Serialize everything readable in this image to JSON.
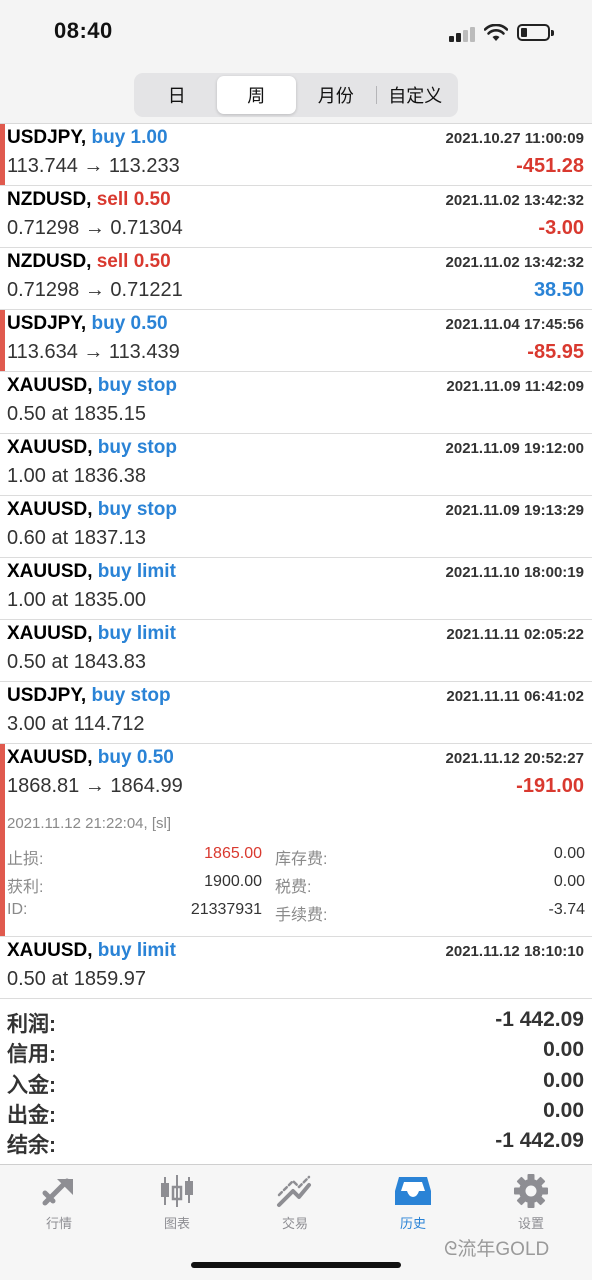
{
  "status": {
    "time": "08:40"
  },
  "segments": [
    {
      "label": "日"
    },
    {
      "label": "周",
      "active": true
    },
    {
      "label": "月份"
    },
    {
      "label": "自定义"
    }
  ],
  "rows": [
    {
      "symbol": "USDJPY,",
      "dir": "buy 1.00",
      "dir_type": "buy",
      "time": "2021.10.27 11:00:09",
      "price": "113.744 → 113.233",
      "profit": "-451.28",
      "profit_type": "neg",
      "accent": true
    },
    {
      "symbol": "NZDUSD,",
      "dir": "sell 0.50",
      "dir_type": "sell",
      "time": "2021.11.02 13:42:32",
      "price": "0.71298 → 0.71304",
      "profit": "-3.00",
      "profit_type": "neg",
      "accent": false
    },
    {
      "symbol": "NZDUSD,",
      "dir": "sell 0.50",
      "dir_type": "sell",
      "time": "2021.11.02 13:42:32",
      "price": "0.71298 → 0.71221",
      "profit": "38.50",
      "profit_type": "pos",
      "accent": false
    },
    {
      "symbol": "USDJPY,",
      "dir": "buy 0.50",
      "dir_type": "buy",
      "time": "2021.11.04 17:45:56",
      "price": "113.634 → 113.439",
      "profit": "-85.95",
      "profit_type": "neg",
      "accent": true
    },
    {
      "symbol": "XAUUSD,",
      "dir": "buy stop",
      "dir_type": "buy",
      "time": "2021.11.09 11:42:09",
      "price": "0.50 at 1835.15",
      "profit": "",
      "profit_type": "",
      "accent": false
    },
    {
      "symbol": "XAUUSD,",
      "dir": "buy stop",
      "dir_type": "buy",
      "time": "2021.11.09 19:12:00",
      "price": "1.00 at 1836.38",
      "profit": "",
      "profit_type": "",
      "accent": false
    },
    {
      "symbol": "XAUUSD,",
      "dir": "buy stop",
      "dir_type": "buy",
      "time": "2021.11.09 19:13:29",
      "price": "0.60 at 1837.13",
      "profit": "",
      "profit_type": "",
      "accent": false
    },
    {
      "symbol": "XAUUSD,",
      "dir": "buy limit",
      "dir_type": "buy",
      "time": "2021.11.10 18:00:19",
      "price": "1.00 at 1835.00",
      "profit": "",
      "profit_type": "",
      "accent": false
    },
    {
      "symbol": "XAUUSD,",
      "dir": "buy limit",
      "dir_type": "buy",
      "time": "2021.11.11 02:05:22",
      "price": "0.50 at 1843.83",
      "profit": "",
      "profit_type": "",
      "accent": false
    },
    {
      "symbol": "USDJPY,",
      "dir": "buy stop",
      "dir_type": "buy",
      "time": "2021.11.11 06:41:02",
      "price": "3.00 at 114.712",
      "profit": "",
      "profit_type": "",
      "accent": false
    },
    {
      "symbol": "XAUUSD,",
      "dir": "buy 0.50",
      "dir_type": "buy",
      "time": "2021.11.12 20:52:27",
      "price": "1868.81 → 1864.99",
      "profit": "-191.00",
      "profit_type": "neg",
      "accent": true,
      "expanded": true,
      "detail": {
        "close_info": "2021.11.12 21:22:04, [sl]",
        "sl_label": "止损:",
        "sl_value": "1865.00",
        "swap_label": "库存费:",
        "swap_value": "0.00",
        "tp_label": "获利:",
        "tp_value": "1900.00",
        "tax_label": "税费:",
        "tax_value": "0.00",
        "id_label": "ID:",
        "id_value": "21337931",
        "commission_label": "手续费:",
        "commission_value": "-3.74"
      }
    },
    {
      "symbol": "XAUUSD,",
      "dir": "buy limit",
      "dir_type": "buy",
      "time": "2021.11.12 18:10:10",
      "price": "0.50 at 1859.97",
      "profit": "",
      "profit_type": "",
      "accent": false
    }
  ],
  "summary": [
    {
      "label": "利润:",
      "value": "-1 442.09"
    },
    {
      "label": "信用:",
      "value": "0.00"
    },
    {
      "label": "入金:",
      "value": "0.00"
    },
    {
      "label": "出金:",
      "value": "0.00"
    },
    {
      "label": "结余:",
      "value": "-1 442.09"
    }
  ],
  "tabs": [
    {
      "label": "行情",
      "icon": "quotes-icon"
    },
    {
      "label": "图表",
      "icon": "chart-icon"
    },
    {
      "label": "交易",
      "icon": "trade-icon"
    },
    {
      "label": "历史",
      "icon": "history-icon",
      "active": true
    },
    {
      "label": "设置",
      "icon": "settings-icon"
    }
  ],
  "watermark": "流年GOLD",
  "colors": {
    "buy": "#2a83d6",
    "sell": "#d9392f",
    "accent_bar": "#e05a4e",
    "active_tab": "#2a83d6"
  }
}
